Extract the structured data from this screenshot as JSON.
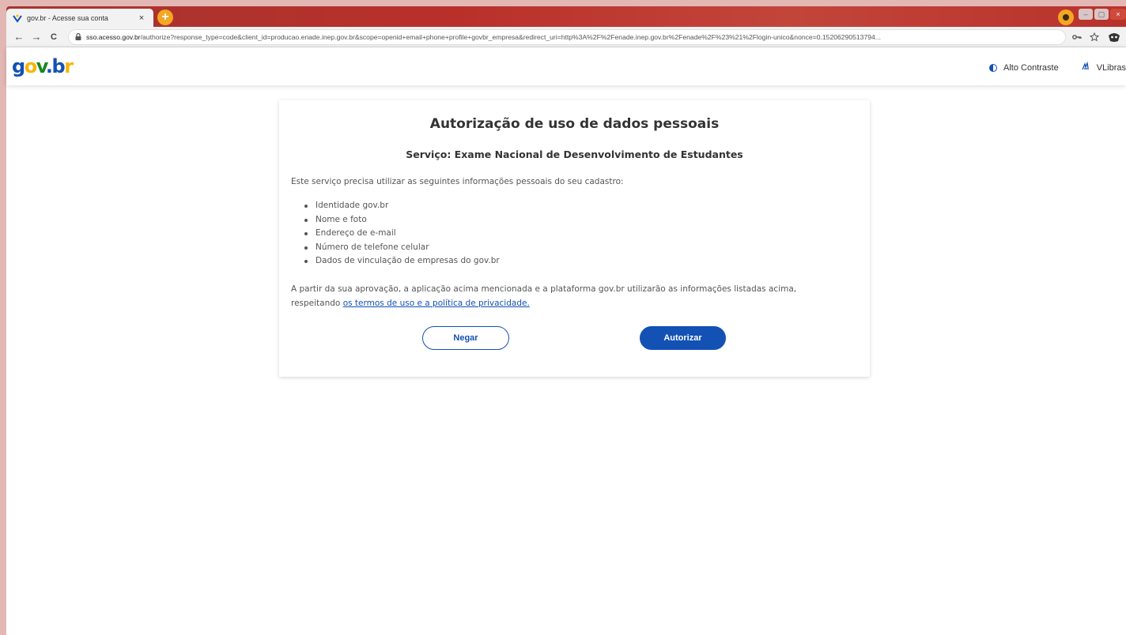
{
  "browser": {
    "tab_title": "gov.br - Acesse sua conta",
    "tab_close": "×",
    "new_tab": "+",
    "url_host": "sso.acesso.gov.br",
    "url_path": "/authorize?response_type=code&client_id=producao.enade.inep.gov.br&scope=openid+email+phone+profile+govbr_empresa&redirect_uri=http%3A%2F%2Fenade.inep.gov.br%2Fenade%2F%23%21%2Flogin-unico&nonce=0.15206290513794...",
    "back": "←",
    "forward": "→",
    "reload": "C",
    "window_minimize": "–",
    "window_restore": "▢",
    "window_close": "×"
  },
  "header": {
    "logo": {
      "g": "g",
      "o": "o",
      "v": "v",
      "dot": ".",
      "b": "b",
      "r": "r"
    },
    "contrast_label": "Alto Contraste",
    "vlibras_label": "VLibras"
  },
  "card": {
    "title": "Autorização de uso de dados pessoais",
    "service": "Serviço: Exame Nacional de Desenvolvimento de Estudantes",
    "intro": "Este serviço precisa utilizar as seguintes informações pessoais do seu cadastro:",
    "items": [
      "Identidade gov.br",
      "Nome e foto",
      "Endereço de e-mail",
      "Número de telefone celular",
      "Dados de vinculação de empresas do gov.br"
    ],
    "note_prefix": "A partir da sua aprovação, a aplicação acima mencionada e a plataforma gov.br utilizarão as informações listadas acima, respeitando ",
    "note_link": "os termos de uso e a política de privacidade.",
    "deny_label": "Negar",
    "authorize_label": "Autorizar"
  },
  "colors": {
    "primary": "#1351b4",
    "logo_yellow": "#f7b500",
    "logo_green": "#168821"
  }
}
